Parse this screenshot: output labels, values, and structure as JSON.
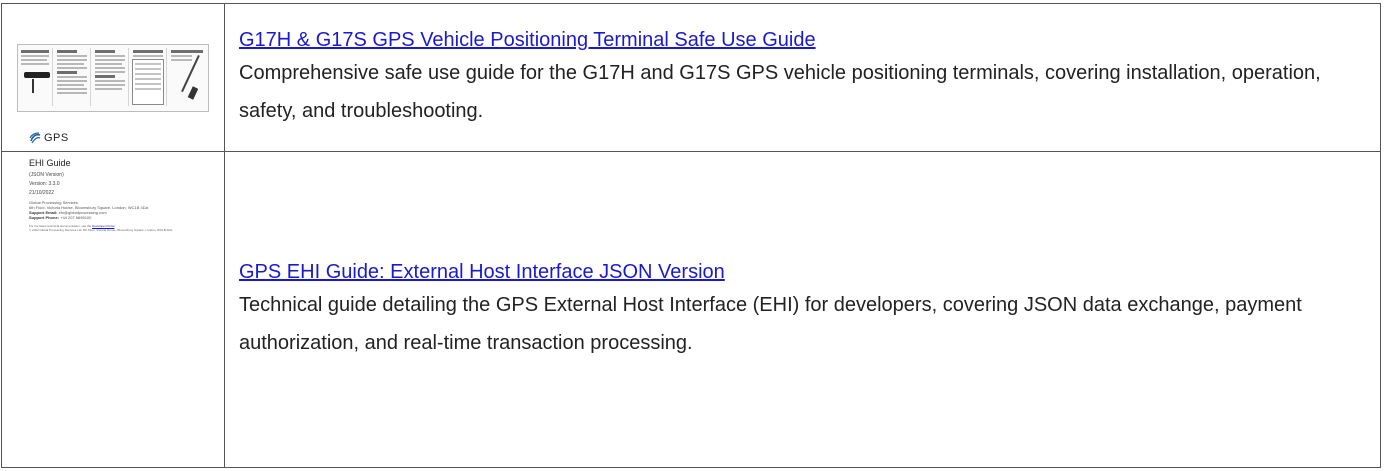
{
  "results": [
    {
      "title": "G17H & G17S GPS Vehicle Positioning Terminal Safe Use Guide",
      "description": "Comprehensive safe use guide for the G17H and G17S GPS vehicle positioning terminals, covering installation, operation, safety, and troubleshooting."
    },
    {
      "title": "GPS EHI Guide: External Host Interface JSON Version",
      "description": "Technical guide detailing the GPS External Host Interface (EHI) for developers, covering JSON data exchange, payment authorization, and real-time transaction processing."
    }
  ],
  "thumb2": {
    "logo_text": "GPS",
    "doc_title": "EHI Guide",
    "version_title": "(JSON Version)",
    "version": "Version: 3.3.0",
    "date": "21/10/2022",
    "company": "Global Processing Services",
    "address": "6th Floor, Victoria House, Bloomsbury Square, London, WC1B 4DA",
    "support_email_label": "Support Email:",
    "support_email": "ehi@globalprocessing.com",
    "support_phone_label": "Support Phone:",
    "support_phone": "+44 207 6696100",
    "footer_text": "For the latest technical documentation, see the",
    "footer_link": "Developer Portal",
    "copyright": "© 2022 Global Processing Services Ltd. 6th Floor, Victoria House, Bloomsbury Square, London, WC1B 4DA"
  },
  "colors": {
    "link": "#1a1acc",
    "text": "#222222",
    "border": "#555555",
    "logo_blue": "#1f5fa8"
  },
  "icons": {
    "gps_logo": "swirl-globe-icon"
  }
}
